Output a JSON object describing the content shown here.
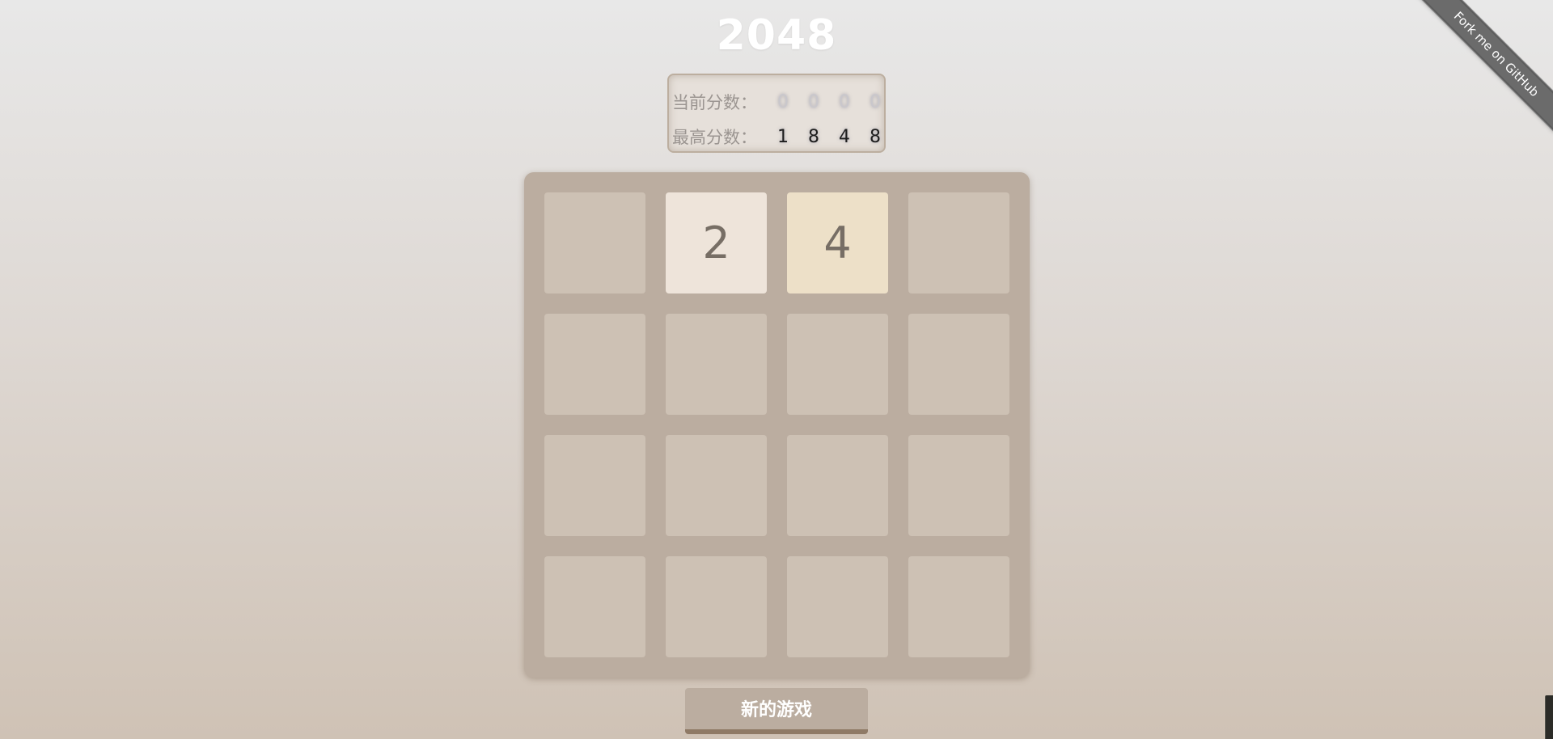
{
  "game": {
    "title": "2048"
  },
  "scores": {
    "current_label": "当前分数：",
    "current_digits": [
      "0",
      "0",
      "0",
      "0"
    ],
    "best_label": "最高分数：",
    "best_digits": [
      "1",
      "8",
      "4",
      "8"
    ]
  },
  "board": {
    "rows": [
      [
        "",
        "2",
        "4",
        ""
      ],
      [
        "",
        "",
        "",
        ""
      ],
      [
        "",
        "",
        "",
        ""
      ],
      [
        "",
        "",
        "",
        ""
      ]
    ],
    "colors": {
      "board": "#bbada0",
      "empty": "#cdc1b4",
      "tile_2": "#eee4da",
      "tile_4": "#ede0c8",
      "tile_text": "#776e65"
    }
  },
  "controls": {
    "new_game_label": "新的游戏"
  },
  "ribbon": {
    "label": "Fork me on GitHub"
  }
}
